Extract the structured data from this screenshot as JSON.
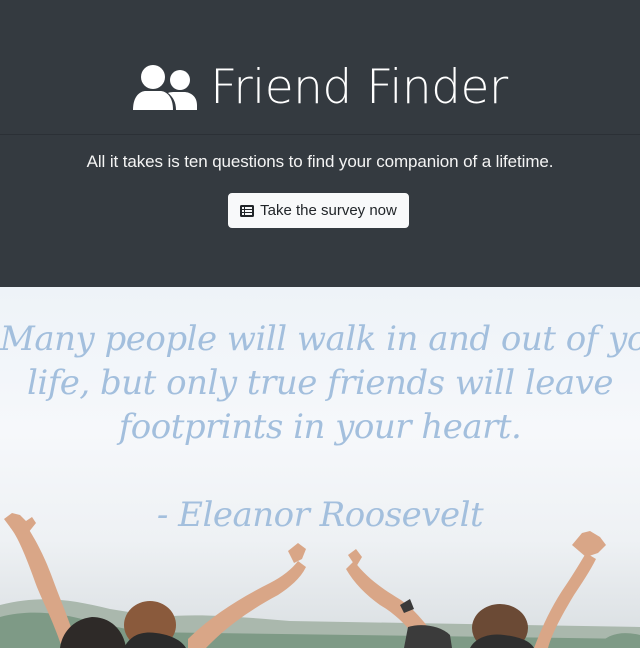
{
  "header": {
    "brand_icon": "user-friends-icon",
    "title": "Friend Finder",
    "tagline": "All it takes is ten questions to find your companion of a lifetime.",
    "button": {
      "icon": "list-icon",
      "label": "Take the survey now"
    }
  },
  "hero": {
    "quote_lines": [
      "Many people will walk in and out of your",
      "life, but only true friends will leave",
      "footprints in your heart."
    ],
    "author": "- Eleanor Roosevelt"
  },
  "colors": {
    "header_bg": "#343a40",
    "button_bg": "#f8f9fa",
    "quote_text": "#a3bfdd"
  }
}
